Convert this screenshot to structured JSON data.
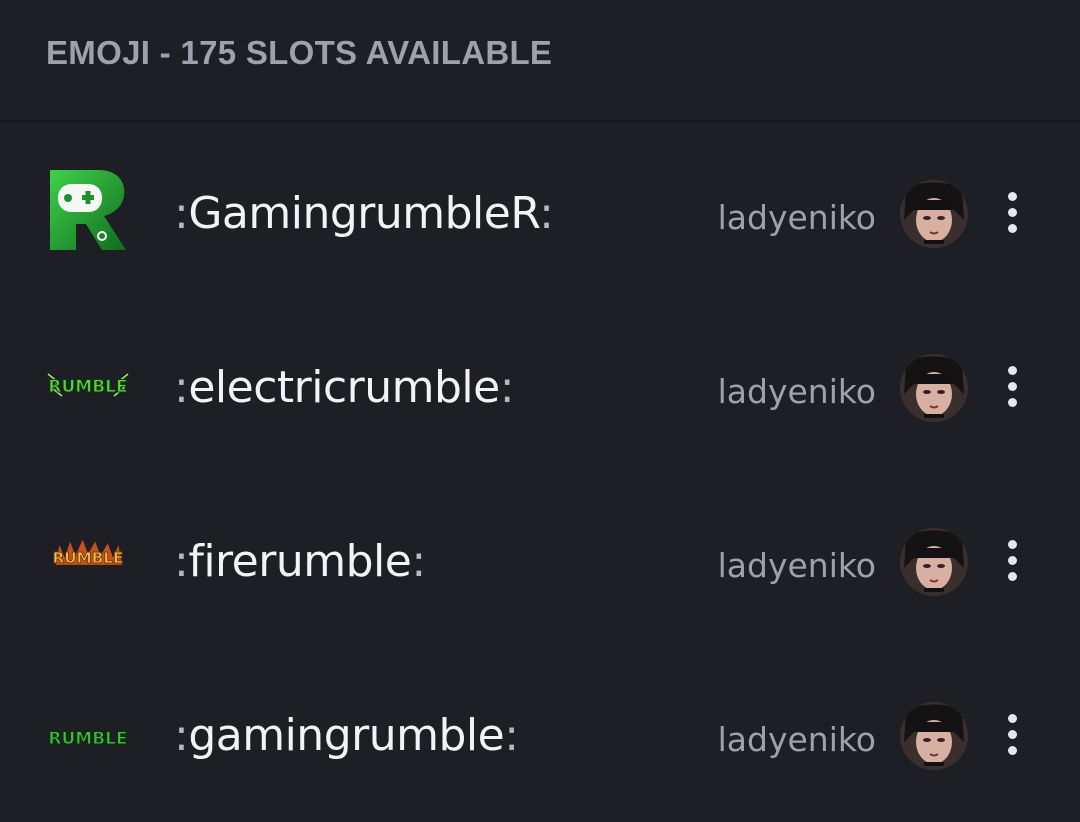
{
  "header": {
    "title": "EMOJI - 175 SLOTS AVAILABLE"
  },
  "emojis": [
    {
      "icon": "gaming-r-logo-icon",
      "name": "GamingrumbleR",
      "uploader": "ladyeniko",
      "accent": "#1e8f2e"
    },
    {
      "icon": "electric-rumble-logo-icon",
      "name": "electricrumble",
      "uploader": "ladyeniko",
      "accent": "#5bd23a"
    },
    {
      "icon": "fire-rumble-logo-icon",
      "name": "firerumble",
      "uploader": "ladyeniko",
      "accent": "#e8a020"
    },
    {
      "icon": "gaming-rumble-logo-icon",
      "name": "gamingrumble",
      "uploader": "ladyeniko",
      "accent": "#3fbf3a"
    }
  ],
  "emoji_logo_text": "RUMBLE",
  "colon": ":"
}
